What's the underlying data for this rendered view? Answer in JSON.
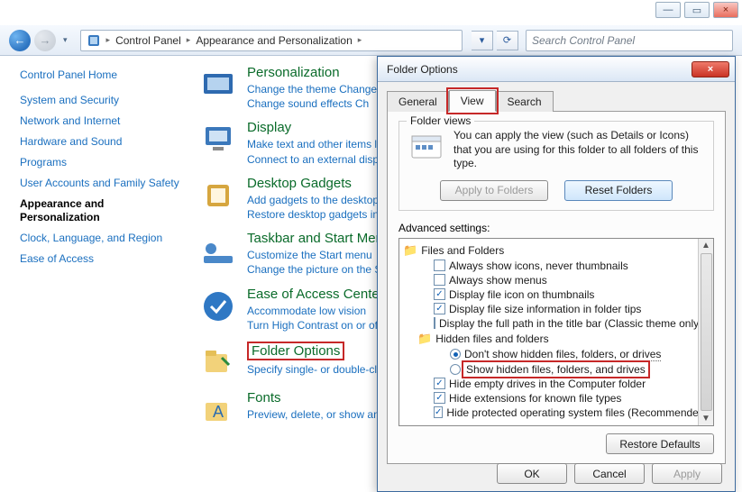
{
  "window_controls": {
    "min": "—",
    "max": "▭",
    "close": "×"
  },
  "nav": {
    "back_glyph": "←",
    "fwd_glyph": "→",
    "chevron": "▾",
    "crumbs": [
      "Control Panel",
      "Appearance and Personalization"
    ],
    "sep": "▸",
    "refresh": "⟳",
    "dropdown": "▾"
  },
  "search": {
    "placeholder": "Search Control Panel"
  },
  "sidebar": {
    "home": "Control Panel Home",
    "items": [
      "System and Security",
      "Network and Internet",
      "Hardware and Sound",
      "Programs",
      "User Accounts and Family Safety",
      "Appearance and Personalization",
      "Clock, Language, and Region",
      "Ease of Access"
    ],
    "current": "Appearance and Personalization"
  },
  "categories": [
    {
      "title": "Personalization",
      "lines": [
        "Change the theme    Change",
        "Change sound effects    Ch"
      ]
    },
    {
      "title": "Display",
      "lines": [
        "Make text and other items la",
        "Connect to an external displa"
      ]
    },
    {
      "title": "Desktop Gadgets",
      "lines": [
        "Add gadgets to the desktop",
        "Restore desktop gadgets inst"
      ]
    },
    {
      "title": "Taskbar and Start Men",
      "lines": [
        "Customize the Start menu",
        "Change the picture on the St"
      ]
    },
    {
      "title": "Ease of Access Center",
      "lines": [
        "Accommodate low vision",
        "Turn High Contrast on or off"
      ]
    },
    {
      "title": "Folder Options",
      "lines": [
        "Specify single- or double-clic"
      ],
      "highlight": true
    },
    {
      "title": "Fonts",
      "lines": [
        "Preview, delete, or show and"
      ]
    }
  ],
  "dialog": {
    "title": "Folder Options",
    "close": "×",
    "tabs": [
      "General",
      "View",
      "Search"
    ],
    "active_tab": "View",
    "folder_views": {
      "legend": "Folder views",
      "text": "You can apply the view (such as Details or Icons) that you are using for this folder to all folders of this type.",
      "apply": "Apply to Folders",
      "reset": "Reset Folders"
    },
    "advanced_label": "Advanced settings:",
    "tree": {
      "root": "Files and Folders",
      "items": [
        {
          "type": "check",
          "checked": false,
          "label": "Always show icons, never thumbnails"
        },
        {
          "type": "check",
          "checked": false,
          "label": "Always show menus"
        },
        {
          "type": "check",
          "checked": true,
          "label": "Display file icon on thumbnails"
        },
        {
          "type": "check",
          "checked": true,
          "label": "Display file size information in folder tips"
        },
        {
          "type": "check",
          "checked": false,
          "label": "Display the full path in the title bar (Classic theme only)"
        },
        {
          "type": "folder",
          "label": "Hidden files and folders"
        },
        {
          "type": "radio",
          "checked": true,
          "indent": 3,
          "label": "Don't show hidden files, folders, or drives",
          "underline": true
        },
        {
          "type": "radio",
          "checked": false,
          "indent": 3,
          "label": "Show hidden files, folders, and drives",
          "highlight": true
        },
        {
          "type": "check",
          "checked": true,
          "label": "Hide empty drives in the Computer folder"
        },
        {
          "type": "check",
          "checked": true,
          "label": "Hide extensions for known file types"
        },
        {
          "type": "check",
          "checked": true,
          "label": "Hide protected operating system files (Recommended)"
        }
      ]
    },
    "restore": "Restore Defaults",
    "ok": "OK",
    "cancel": "Cancel",
    "apply": "Apply"
  }
}
